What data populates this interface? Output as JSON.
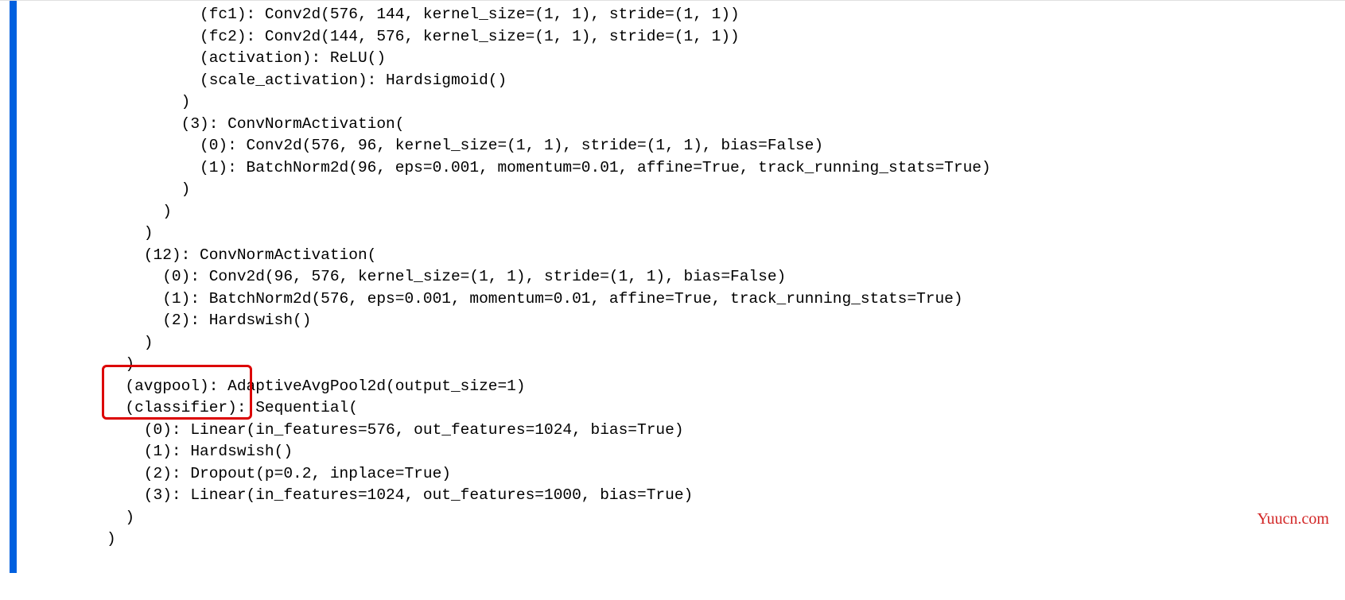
{
  "code": {
    "lines": [
      "          (fc1): Conv2d(576, 144, kernel_size=(1, 1), stride=(1, 1))",
      "          (fc2): Conv2d(144, 576, kernel_size=(1, 1), stride=(1, 1))",
      "          (activation): ReLU()",
      "          (scale_activation): Hardsigmoid()",
      "        )",
      "        (3): ConvNormActivation(",
      "          (0): Conv2d(576, 96, kernel_size=(1, 1), stride=(1, 1), bias=False)",
      "          (1): BatchNorm2d(96, eps=0.001, momentum=0.01, affine=True, track_running_stats=True)",
      "        )",
      "      )",
      "    )",
      "    (12): ConvNormActivation(",
      "      (0): Conv2d(96, 576, kernel_size=(1, 1), stride=(1, 1), bias=False)",
      "      (1): BatchNorm2d(576, eps=0.001, momentum=0.01, affine=True, track_running_stats=True)",
      "      (2): Hardswish()",
      "    )",
      "  )",
      "  (avgpool): AdaptiveAvgPool2d(output_size=1)",
      "  (classifier): Sequential(",
      "    (0): Linear(in_features=576, out_features=1024, bias=True)",
      "    (1): Hardswish()",
      "    (2): Dropout(p=0.2, inplace=True)",
      "    (3): Linear(in_features=1024, out_features=1000, bias=True)",
      "  )",
      ")"
    ]
  },
  "watermark": "Yuucn.com"
}
